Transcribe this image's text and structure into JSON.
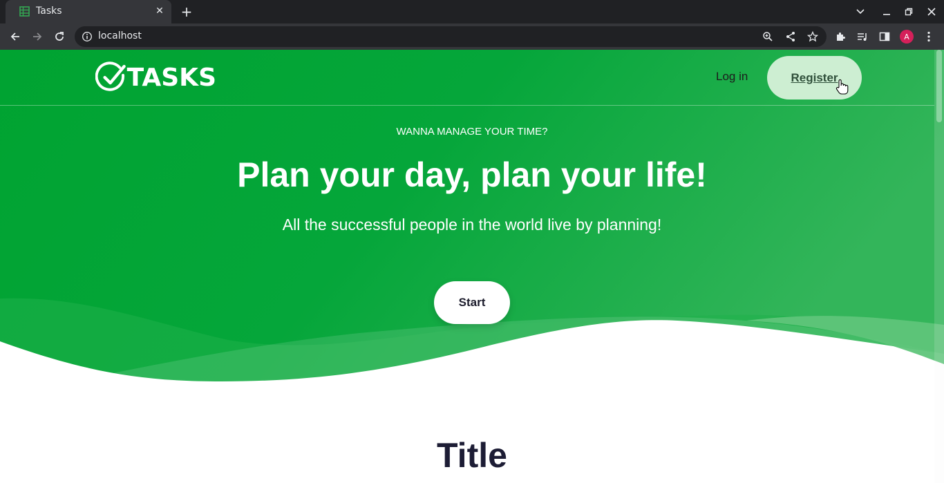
{
  "browser": {
    "tab_title": "Tasks",
    "url": "localhost",
    "profile_initial": "A"
  },
  "nav": {
    "logo_text": "TASKS",
    "login_label": "Log in",
    "register_label": "Register"
  },
  "hero": {
    "kicker": "WANNA MANAGE YOUR TIME?",
    "headline": "Plan your day, plan your life!",
    "subline": "All the successful people in the world live by planning!",
    "cta_label": "Start"
  },
  "section": {
    "title": "Title"
  },
  "colors": {
    "brand_green": "#00a33a",
    "brand_green_light": "#3db55a",
    "register_bg": "#cdeed2"
  }
}
